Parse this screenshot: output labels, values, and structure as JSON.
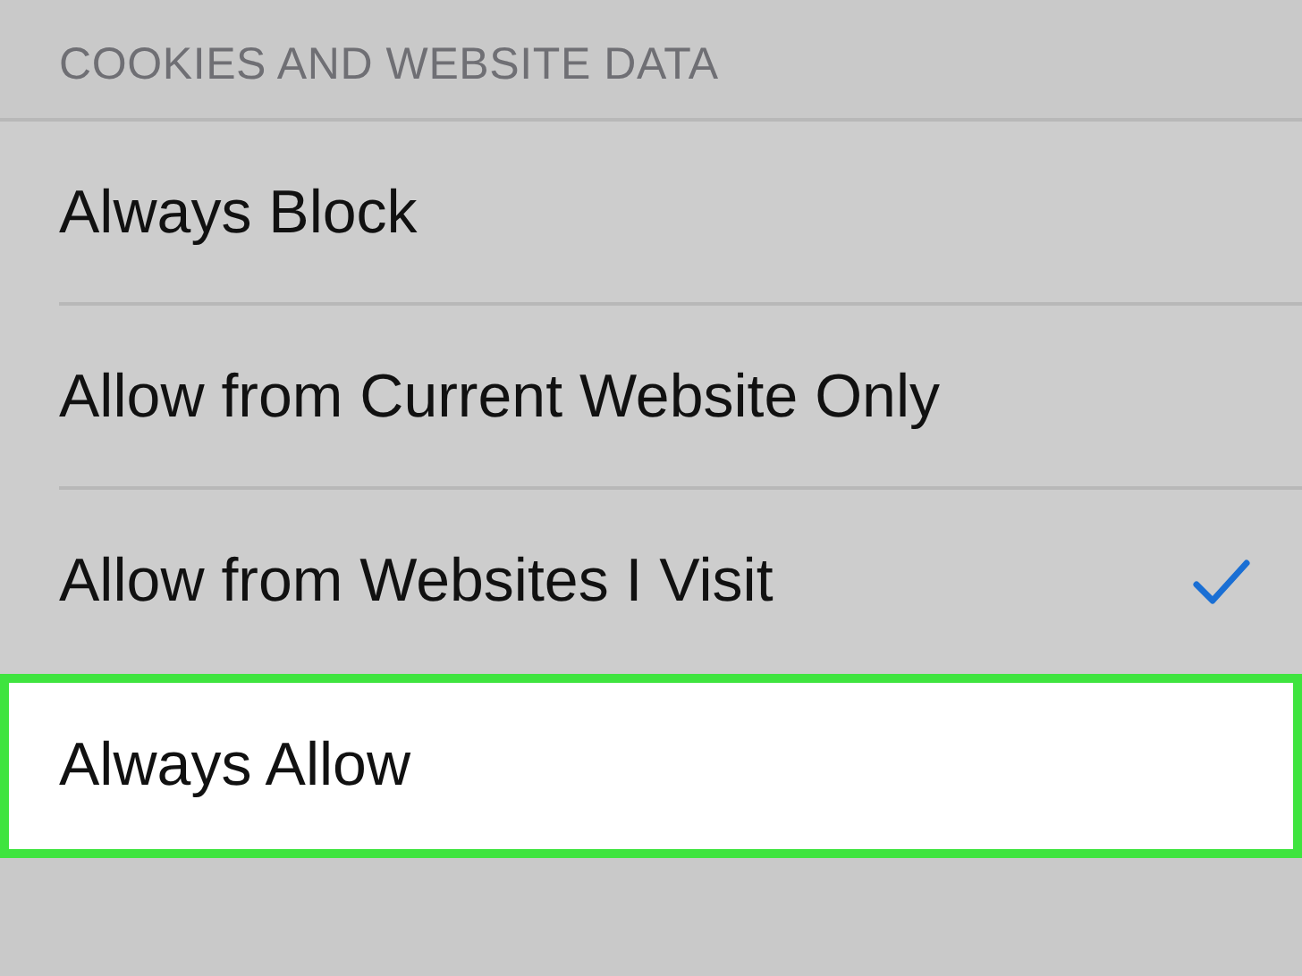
{
  "section_header": "COOKIES AND WEBSITE DATA",
  "options": [
    {
      "label": "Always Block",
      "selected": false,
      "highlighted": false
    },
    {
      "label": "Allow from Current Website Only",
      "selected": false,
      "highlighted": false
    },
    {
      "label": "Allow from Websites I Visit",
      "selected": true,
      "highlighted": false
    },
    {
      "label": "Always Allow",
      "selected": false,
      "highlighted": true
    }
  ]
}
